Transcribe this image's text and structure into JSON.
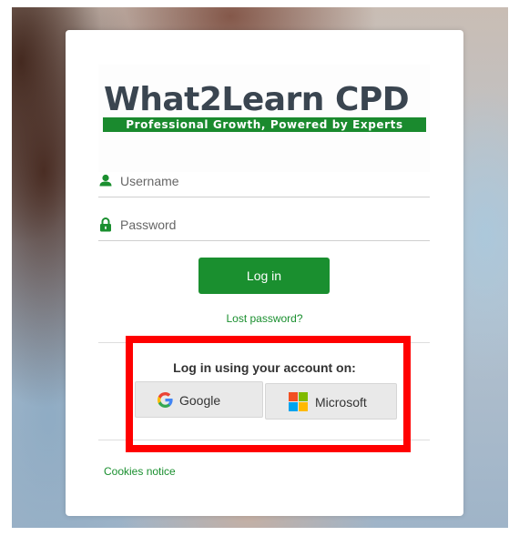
{
  "brand": {
    "title": "What2Learn CPD",
    "tagline": "Professional Growth, Powered by Experts",
    "accent_color": "#1a8f2f"
  },
  "login_form": {
    "username": {
      "placeholder": "Username",
      "value": "",
      "icon": "user-icon"
    },
    "password": {
      "placeholder": "Password",
      "value": "",
      "icon": "lock-icon"
    },
    "submit_label": "Log in",
    "lost_password_label": "Lost password?"
  },
  "sso": {
    "heading": "Log in using your account on:",
    "providers": [
      {
        "label": "Google",
        "icon": "google-icon"
      },
      {
        "label": "Microsoft",
        "icon": "microsoft-icon"
      }
    ]
  },
  "footer": {
    "cookies_label": "Cookies notice"
  },
  "annotation": {
    "highlight_color": "#ff0000"
  }
}
